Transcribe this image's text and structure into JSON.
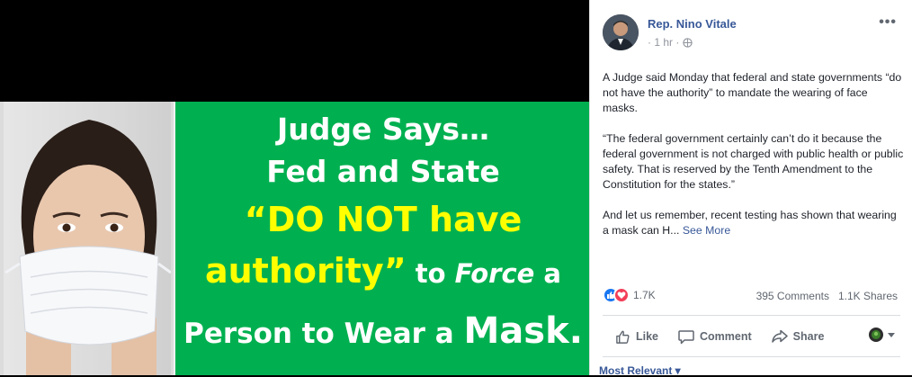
{
  "image": {
    "headline": {
      "line1": "Judge Says…",
      "line2": "Fed and State",
      "line3": "“DO NOT have",
      "line4_yellow": "authority”",
      "line4_white_a": " to ",
      "line4_italic": "Force",
      "line4_white_b": " a",
      "line5_a": "Person to Wear a ",
      "line5_big": "Mask."
    },
    "colors": {
      "green": "#00b050",
      "yellow": "#ffff00"
    }
  },
  "post": {
    "author": "Rep. Nino Vitale",
    "time": "· 1 hr ·",
    "paragraphs": [
      "A Judge said Monday that federal and state governments “do not have the authority” to mandate the wearing of face masks.",
      "“The federal government certainly can’t do it because the federal government is not charged with public health or public safety. That is reserved by the Tenth Amendment to the Constitution for the states.”",
      "And let us remember, recent testing has shown that wearing a mask can H... "
    ],
    "see_more": "See More",
    "reaction_count": "1.7K",
    "comments": "395 Comments",
    "shares": "1.1K Shares",
    "actions": {
      "like": "Like",
      "comment": "Comment",
      "share": "Share"
    },
    "sort_label": "Most Relevant ▾",
    "icons": [
      "more-icon",
      "globe-icon",
      "like-icon",
      "love-icon",
      "thumbs-up-icon",
      "comment-icon",
      "share-icon",
      "caret-down-icon"
    ]
  }
}
